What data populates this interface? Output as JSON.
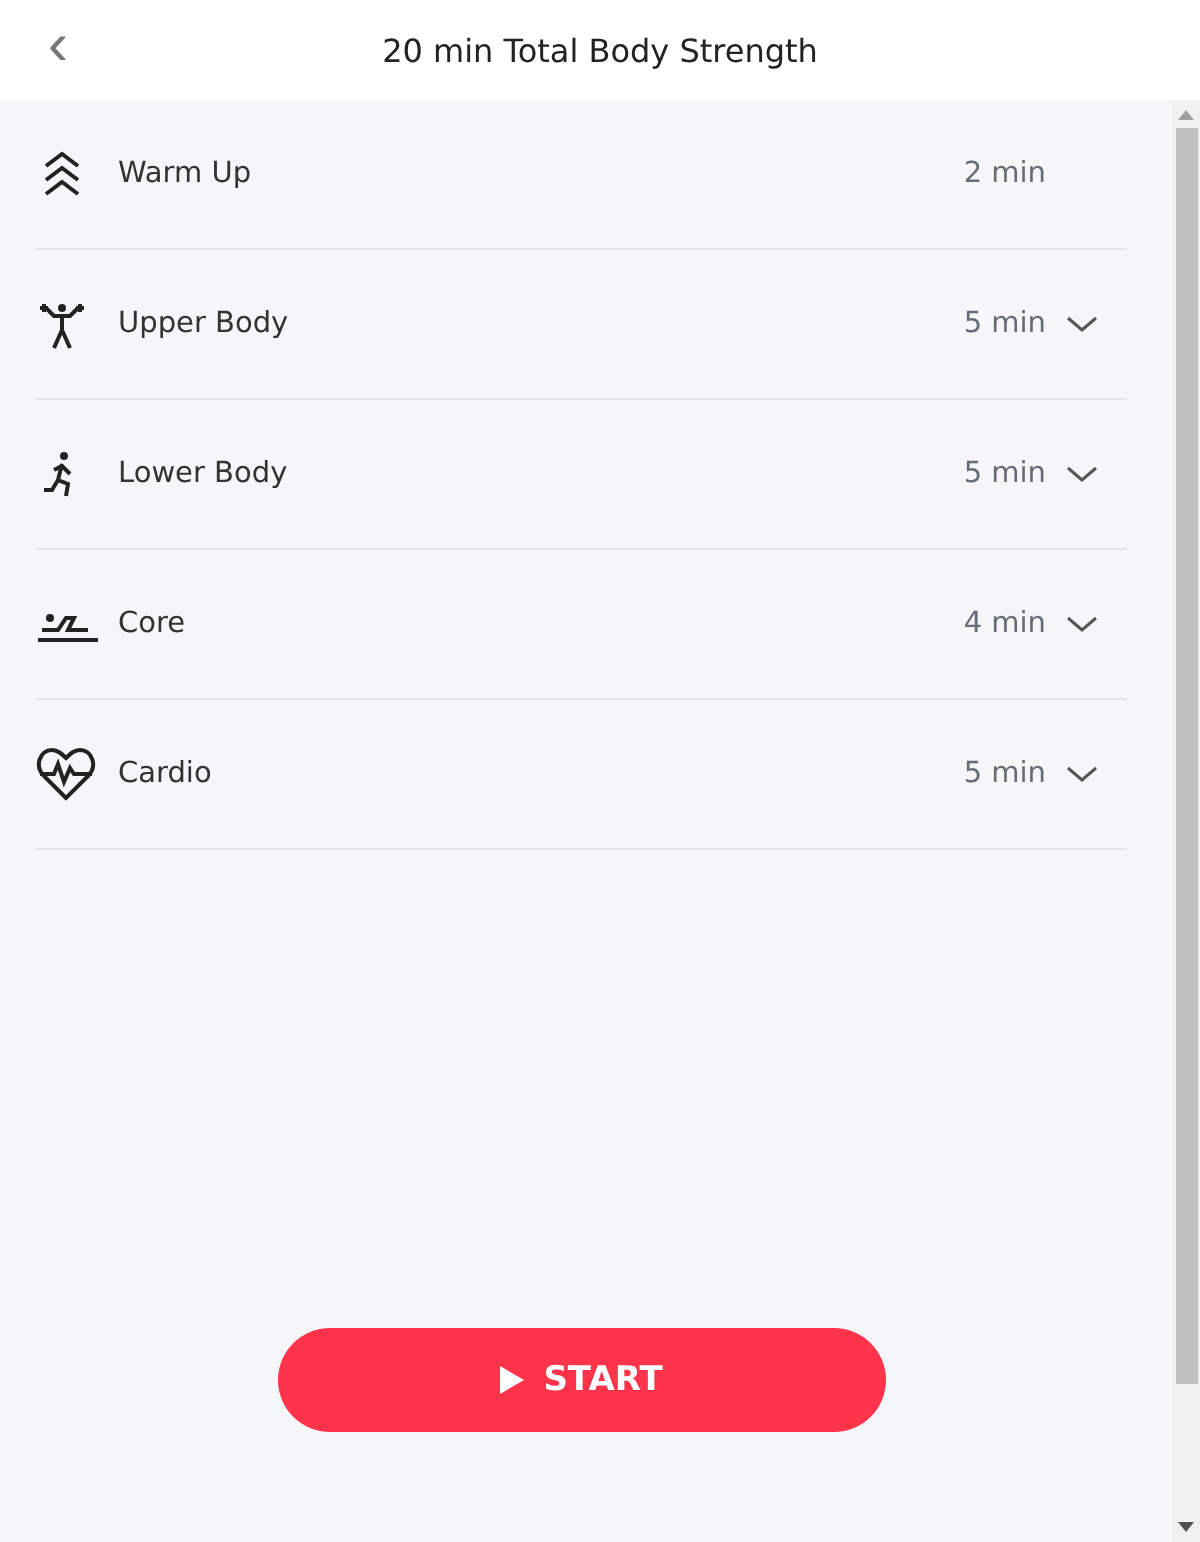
{
  "header": {
    "back": "‹",
    "title": "20 min Total Body Strength"
  },
  "sections": [
    {
      "kind": "warmup",
      "name": "Warm Up",
      "duration": "2 min",
      "expandable": false
    },
    {
      "kind": "upper",
      "name": "Upper Body",
      "duration": "5 min",
      "expandable": true
    },
    {
      "kind": "lower",
      "name": "Lower Body",
      "duration": "5 min",
      "expandable": true
    },
    {
      "kind": "core",
      "name": "Core",
      "duration": "4 min",
      "expandable": true
    },
    {
      "kind": "cardio",
      "name": "Cardio",
      "duration": "5 min",
      "expandable": true
    }
  ],
  "start_button": {
    "label": "START"
  }
}
